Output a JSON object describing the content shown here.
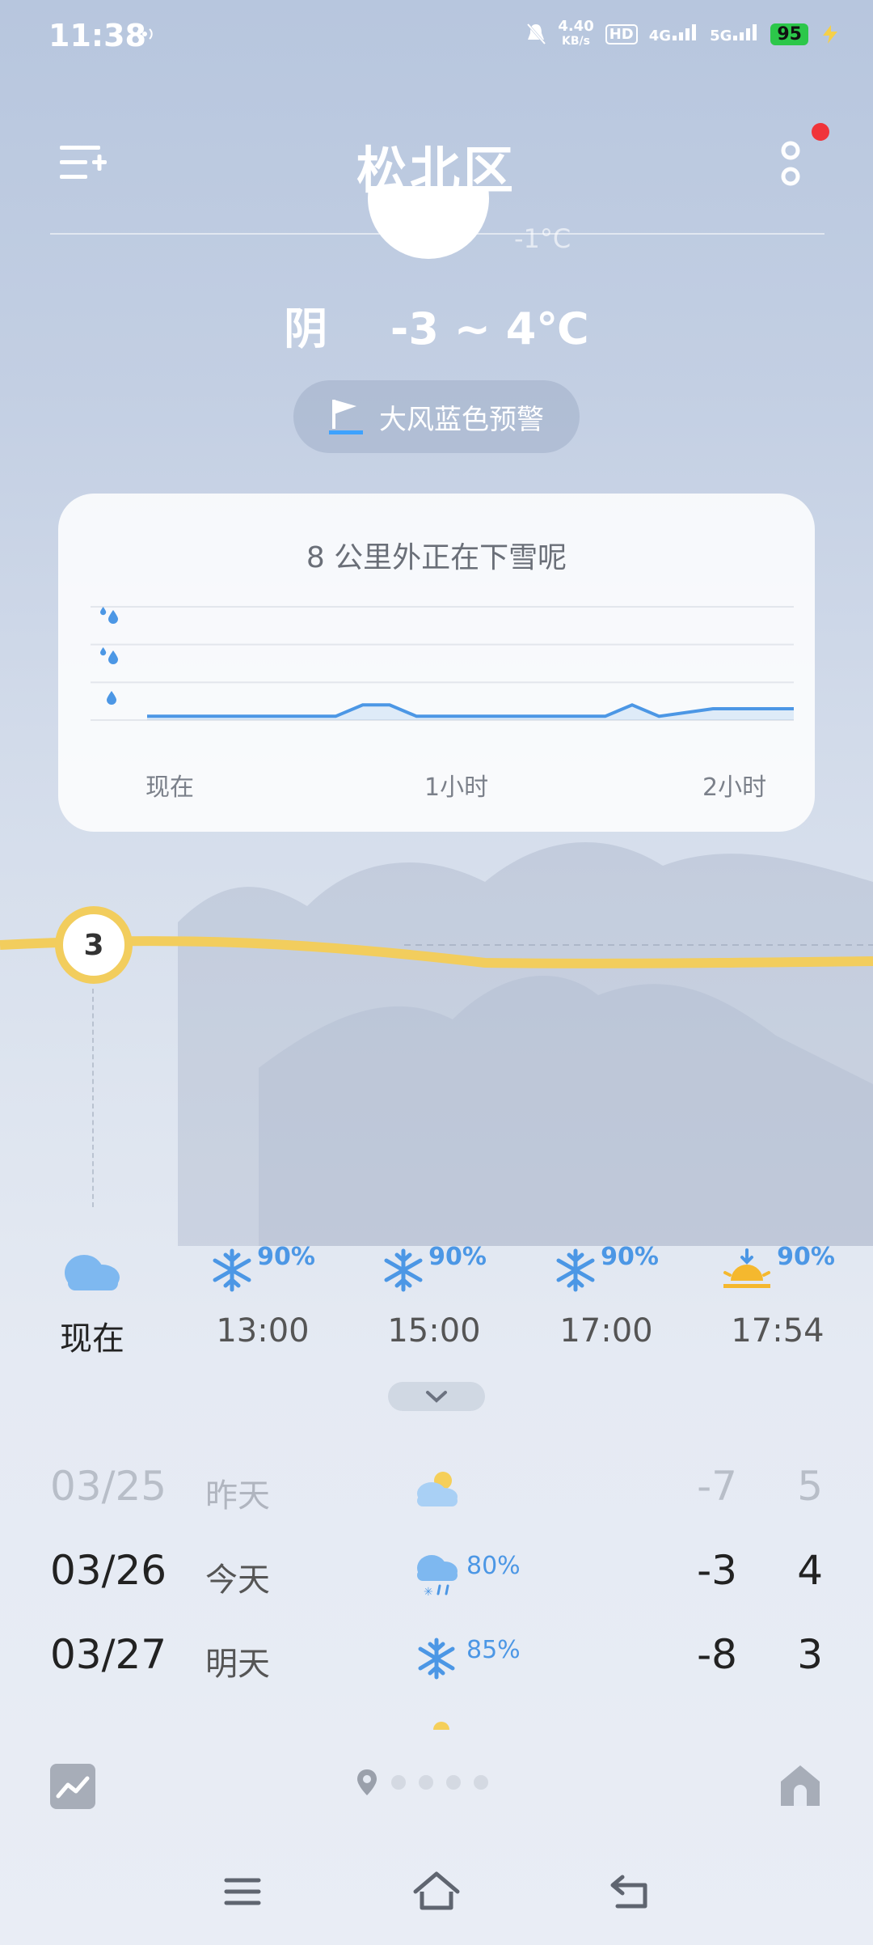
{
  "status_bar": {
    "time": "11:38",
    "network_speed": "4.40",
    "network_speed_unit": "KB/s",
    "signal_1": "4G",
    "signal_2": "5G",
    "battery": "95"
  },
  "header": {
    "title": "松北区",
    "menu_icon": "add-list-icon",
    "more_icon": "more-vertical-icon",
    "notification_dot_color": "#f0343a"
  },
  "current": {
    "partial_temp": "-1°C",
    "condition": "阴",
    "range": "-3 ~ 4℃",
    "warning": "大风蓝色预警",
    "line_temp": "3"
  },
  "precip_card": {
    "title": "8 公里外正在下雪呢",
    "x_labels": [
      "现在",
      "1小时",
      "2小时"
    ],
    "chart_data": {
      "type": "line",
      "x": [
        0,
        20,
        35,
        40,
        45,
        50,
        70,
        85,
        90,
        95,
        105,
        120
      ],
      "y": [
        0.1,
        0.1,
        0.1,
        0.4,
        0.4,
        0.1,
        0.1,
        0.1,
        0.4,
        0.1,
        0.3,
        0.3
      ],
      "xlabel": "",
      "ylabel": "",
      "tick_labels": [
        "现在",
        "1小时",
        "2小时"
      ],
      "ylim": [
        0,
        3
      ],
      "grid": true,
      "color": "#4c97e5"
    }
  },
  "hourly": [
    {
      "time": "现在",
      "icon": "cloud-icon",
      "pct": ""
    },
    {
      "time": "13:00",
      "icon": "snowflake-icon",
      "pct": "90%"
    },
    {
      "time": "15:00",
      "icon": "snowflake-icon",
      "pct": "90%"
    },
    {
      "time": "17:00",
      "icon": "snowflake-icon",
      "pct": "90%"
    },
    {
      "time": "17:54",
      "icon": "sunset-icon",
      "pct": "90%"
    }
  ],
  "daily": [
    {
      "date": "03/25",
      "label": "昨天",
      "icon": "partly-cloudy-icon",
      "pct": "",
      "low": "-7",
      "high": "5"
    },
    {
      "date": "03/26",
      "label": "今天",
      "icon": "rain-snow-icon",
      "pct": "80%",
      "low": "-3",
      "high": "4"
    },
    {
      "date": "03/27",
      "label": "明天",
      "icon": "snowflake-icon",
      "pct": "85%",
      "low": "-8",
      "high": "3"
    }
  ],
  "bottom": {
    "left_icon": "trend-chart-icon",
    "right_icon": "home-icon",
    "page_count": 5
  },
  "colors": {
    "accent_blue": "#4c97e5",
    "temp_line": "#f2cd5d"
  }
}
